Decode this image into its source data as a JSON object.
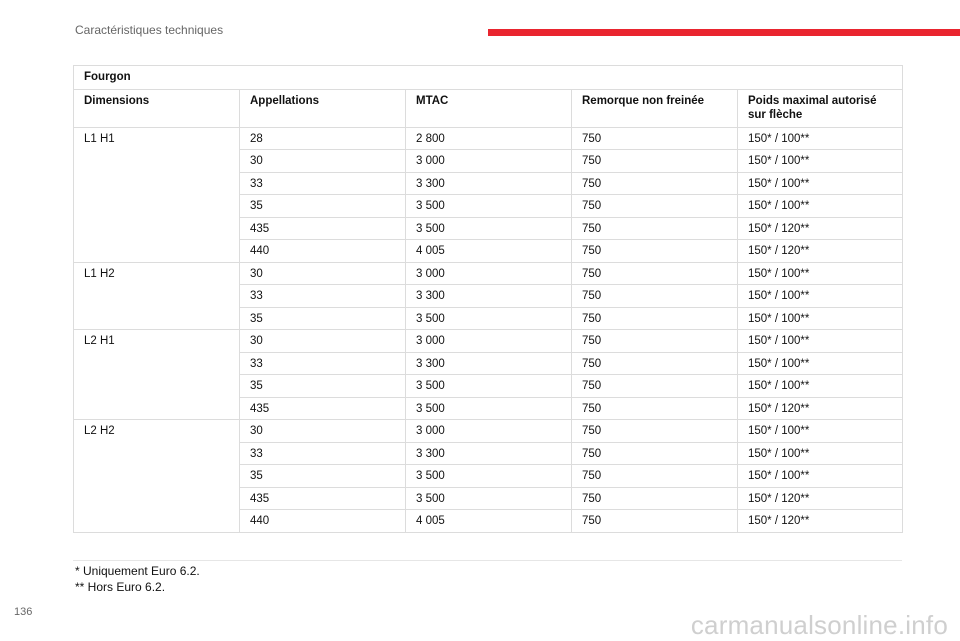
{
  "header": {
    "section_title": "Caractéristiques techniques"
  },
  "table": {
    "title": "Fourgon",
    "columns": [
      "Dimensions",
      "Appellations",
      "MTAC",
      "Remorque non freinée",
      "Poids maximal autorisé sur flèche"
    ],
    "groups": [
      {
        "dimension": "L1 H1",
        "rows": [
          [
            "28",
            "2 800",
            "750",
            "150* / 100**"
          ],
          [
            "30",
            "3 000",
            "750",
            "150* / 100**"
          ],
          [
            "33",
            "3 300",
            "750",
            "150* / 100**"
          ],
          [
            "35",
            "3 500",
            "750",
            "150* / 100**"
          ],
          [
            "435",
            "3 500",
            "750",
            "150* / 120**"
          ],
          [
            "440",
            "4 005",
            "750",
            "150* / 120**"
          ]
        ]
      },
      {
        "dimension": "L1 H2",
        "rows": [
          [
            "30",
            "3 000",
            "750",
            "150* / 100**"
          ],
          [
            "33",
            "3 300",
            "750",
            "150* / 100**"
          ],
          [
            "35",
            "3 500",
            "750",
            "150* / 100**"
          ]
        ]
      },
      {
        "dimension": "L2 H1",
        "rows": [
          [
            "30",
            "3 000",
            "750",
            "150* / 100**"
          ],
          [
            "33",
            "3 300",
            "750",
            "150* / 100**"
          ],
          [
            "35",
            "3 500",
            "750",
            "150* / 100**"
          ],
          [
            "435",
            "3 500",
            "750",
            "150* / 120**"
          ]
        ]
      },
      {
        "dimension": "L2 H2",
        "rows": [
          [
            "30",
            "3 000",
            "750",
            "150* / 100**"
          ],
          [
            "33",
            "3 300",
            "750",
            "150* / 100**"
          ],
          [
            "35",
            "3 500",
            "750",
            "150* / 100**"
          ],
          [
            "435",
            "3 500",
            "750",
            "150* / 120**"
          ],
          [
            "440",
            "4 005",
            "750",
            "150* / 120**"
          ]
        ]
      }
    ]
  },
  "footnotes": [
    "* Uniquement Euro 6.2.",
    "** Hors Euro 6.2."
  ],
  "page_number": "136",
  "watermark": "carmanualsonline.info",
  "colors": {
    "accent": "#e9252f"
  }
}
